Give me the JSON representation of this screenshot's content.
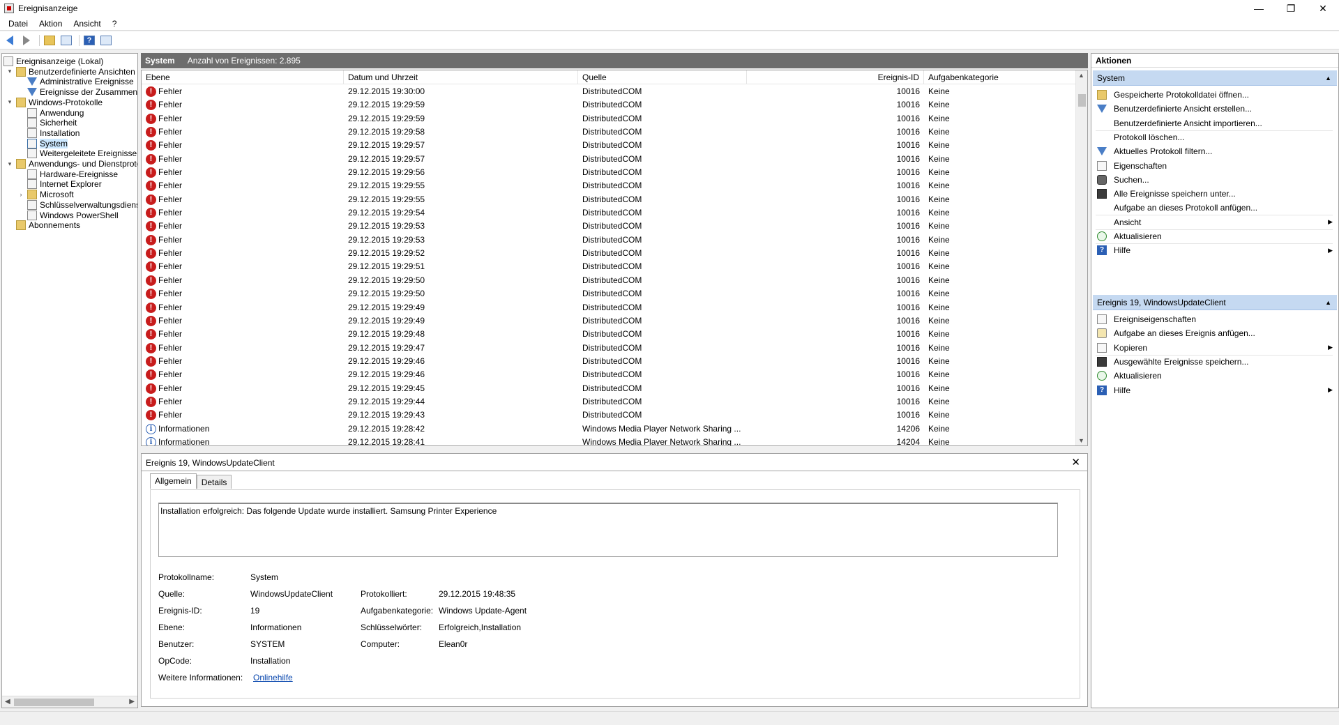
{
  "window": {
    "title": "Ereignisanzeige"
  },
  "menu": [
    "Datei",
    "Aktion",
    "Ansicht",
    "?"
  ],
  "tree": [
    {
      "label": "Ereignisanzeige (Lokal)",
      "level": 0,
      "icon": "eventviewer-icon",
      "twisty": ""
    },
    {
      "label": "Benutzerdefinierte Ansichten",
      "level": 1,
      "icon": "folder-icon",
      "twisty": "▾"
    },
    {
      "label": "Administrative Ereignisse",
      "level": 2,
      "icon": "filter-icon",
      "twisty": ""
    },
    {
      "label": "Ereignisse der Zusammenfassungsseite",
      "level": 2,
      "icon": "filter-icon",
      "twisty": ""
    },
    {
      "label": "Windows-Protokolle",
      "level": 1,
      "icon": "folder-icon",
      "twisty": "▾"
    },
    {
      "label": "Anwendung",
      "level": 2,
      "icon": "log-icon",
      "twisty": ""
    },
    {
      "label": "Sicherheit",
      "level": 2,
      "icon": "log-icon",
      "twisty": ""
    },
    {
      "label": "Installation",
      "level": 2,
      "icon": "log-icon",
      "twisty": ""
    },
    {
      "label": "System",
      "level": 2,
      "icon": "log-icon",
      "twisty": "",
      "selected": true
    },
    {
      "label": "Weitergeleitete Ereignisse",
      "level": 2,
      "icon": "log-icon",
      "twisty": ""
    },
    {
      "label": "Anwendungs- und Dienstprotokolle",
      "level": 1,
      "icon": "folder-icon",
      "twisty": "▾"
    },
    {
      "label": "Hardware-Ereignisse",
      "level": 2,
      "icon": "log-icon",
      "twisty": ""
    },
    {
      "label": "Internet Explorer",
      "level": 2,
      "icon": "log-icon",
      "twisty": ""
    },
    {
      "label": "Microsoft",
      "level": 2,
      "icon": "folder-icon",
      "twisty": "›"
    },
    {
      "label": "Schlüsselverwaltungsdienst",
      "level": 2,
      "icon": "log-icon",
      "twisty": ""
    },
    {
      "label": "Windows PowerShell",
      "level": 2,
      "icon": "log-icon",
      "twisty": ""
    },
    {
      "label": "Abonnements",
      "level": 1,
      "icon": "folder-icon",
      "twisty": ""
    }
  ],
  "list": {
    "name": "System",
    "count_text": "Anzahl von Ereignissen: 2.895",
    "columns": [
      "Ebene",
      "Datum und Uhrzeit",
      "Quelle",
      "Ereignis-ID",
      "Aufgabenkategorie"
    ],
    "rows": [
      {
        "level": "Fehler",
        "type": "err",
        "date": "29.12.2015 19:30:00",
        "source": "DistributedCOM",
        "id": "10016",
        "category": "Keine"
      },
      {
        "level": "Fehler",
        "type": "err",
        "date": "29.12.2015 19:29:59",
        "source": "DistributedCOM",
        "id": "10016",
        "category": "Keine"
      },
      {
        "level": "Fehler",
        "type": "err",
        "date": "29.12.2015 19:29:59",
        "source": "DistributedCOM",
        "id": "10016",
        "category": "Keine"
      },
      {
        "level": "Fehler",
        "type": "err",
        "date": "29.12.2015 19:29:58",
        "source": "DistributedCOM",
        "id": "10016",
        "category": "Keine"
      },
      {
        "level": "Fehler",
        "type": "err",
        "date": "29.12.2015 19:29:57",
        "source": "DistributedCOM",
        "id": "10016",
        "category": "Keine"
      },
      {
        "level": "Fehler",
        "type": "err",
        "date": "29.12.2015 19:29:57",
        "source": "DistributedCOM",
        "id": "10016",
        "category": "Keine"
      },
      {
        "level": "Fehler",
        "type": "err",
        "date": "29.12.2015 19:29:56",
        "source": "DistributedCOM",
        "id": "10016",
        "category": "Keine"
      },
      {
        "level": "Fehler",
        "type": "err",
        "date": "29.12.2015 19:29:55",
        "source": "DistributedCOM",
        "id": "10016",
        "category": "Keine"
      },
      {
        "level": "Fehler",
        "type": "err",
        "date": "29.12.2015 19:29:55",
        "source": "DistributedCOM",
        "id": "10016",
        "category": "Keine"
      },
      {
        "level": "Fehler",
        "type": "err",
        "date": "29.12.2015 19:29:54",
        "source": "DistributedCOM",
        "id": "10016",
        "category": "Keine"
      },
      {
        "level": "Fehler",
        "type": "err",
        "date": "29.12.2015 19:29:53",
        "source": "DistributedCOM",
        "id": "10016",
        "category": "Keine"
      },
      {
        "level": "Fehler",
        "type": "err",
        "date": "29.12.2015 19:29:53",
        "source": "DistributedCOM",
        "id": "10016",
        "category": "Keine"
      },
      {
        "level": "Fehler",
        "type": "err",
        "date": "29.12.2015 19:29:52",
        "source": "DistributedCOM",
        "id": "10016",
        "category": "Keine"
      },
      {
        "level": "Fehler",
        "type": "err",
        "date": "29.12.2015 19:29:51",
        "source": "DistributedCOM",
        "id": "10016",
        "category": "Keine"
      },
      {
        "level": "Fehler",
        "type": "err",
        "date": "29.12.2015 19:29:50",
        "source": "DistributedCOM",
        "id": "10016",
        "category": "Keine"
      },
      {
        "level": "Fehler",
        "type": "err",
        "date": "29.12.2015 19:29:50",
        "source": "DistributedCOM",
        "id": "10016",
        "category": "Keine"
      },
      {
        "level": "Fehler",
        "type": "err",
        "date": "29.12.2015 19:29:49",
        "source": "DistributedCOM",
        "id": "10016",
        "category": "Keine"
      },
      {
        "level": "Fehler",
        "type": "err",
        "date": "29.12.2015 19:29:49",
        "source": "DistributedCOM",
        "id": "10016",
        "category": "Keine"
      },
      {
        "level": "Fehler",
        "type": "err",
        "date": "29.12.2015 19:29:48",
        "source": "DistributedCOM",
        "id": "10016",
        "category": "Keine"
      },
      {
        "level": "Fehler",
        "type": "err",
        "date": "29.12.2015 19:29:47",
        "source": "DistributedCOM",
        "id": "10016",
        "category": "Keine"
      },
      {
        "level": "Fehler",
        "type": "err",
        "date": "29.12.2015 19:29:46",
        "source": "DistributedCOM",
        "id": "10016",
        "category": "Keine"
      },
      {
        "level": "Fehler",
        "type": "err",
        "date": "29.12.2015 19:29:46",
        "source": "DistributedCOM",
        "id": "10016",
        "category": "Keine"
      },
      {
        "level": "Fehler",
        "type": "err",
        "date": "29.12.2015 19:29:45",
        "source": "DistributedCOM",
        "id": "10016",
        "category": "Keine"
      },
      {
        "level": "Fehler",
        "type": "err",
        "date": "29.12.2015 19:29:44",
        "source": "DistributedCOM",
        "id": "10016",
        "category": "Keine"
      },
      {
        "level": "Fehler",
        "type": "err",
        "date": "29.12.2015 19:29:43",
        "source": "DistributedCOM",
        "id": "10016",
        "category": "Keine"
      },
      {
        "level": "Informationen",
        "type": "inf",
        "date": "29.12.2015 19:28:42",
        "source": "Windows Media Player Network Sharing ...",
        "id": "14206",
        "category": "Keine"
      },
      {
        "level": "Informationen",
        "type": "inf",
        "date": "29.12.2015 19:28:41",
        "source": "Windows Media Player Network Sharing ...",
        "id": "14204",
        "category": "Keine"
      }
    ]
  },
  "detail": {
    "title": "Ereignis 19, WindowsUpdateClient",
    "tabs": [
      "Allgemein",
      "Details"
    ],
    "message": "Installation erfolgreich: Das folgende Update wurde installiert. Samsung Printer Experience",
    "fields": {
      "protokollname_label": "Protokollname:",
      "protokollname": "System",
      "quelle_label": "Quelle:",
      "quelle": "WindowsUpdateClient",
      "protokolliert_label": "Protokolliert:",
      "protokolliert": "29.12.2015 19:48:35",
      "id_label": "Ereignis-ID:",
      "id": "19",
      "aufgabe_label": "Aufgabenkategorie:",
      "aufgabe": "Windows Update-Agent",
      "ebene_label": "Ebene:",
      "ebene": "Informationen",
      "schluessel_label": "Schlüsselwörter:",
      "schluessel": "Erfolgreich,Installation",
      "benutzer_label": "Benutzer:",
      "benutzer": "SYSTEM",
      "computer_label": "Computer:",
      "computer": "Elean0r",
      "opcode_label": "OpCode:",
      "opcode": "Installation",
      "weitere_label": "Weitere Informationen:",
      "weitere": "Onlinehilfe"
    }
  },
  "actions": {
    "title": "Aktionen",
    "section1": "System",
    "section1_items": [
      {
        "label": "Gespeicherte Protokolldatei öffnen...",
        "icon": "open-icon",
        "sub": false
      },
      {
        "label": "Benutzerdefinierte Ansicht erstellen...",
        "icon": "filter-icon",
        "sub": false
      },
      {
        "label": "Benutzerdefinierte Ansicht importieren...",
        "icon": "blank-icon",
        "sub": false
      },
      {
        "label": "Protokoll löschen...",
        "icon": "blank-icon",
        "sub": false
      },
      {
        "label": "Aktuelles Protokoll filtern...",
        "icon": "filter-icon",
        "sub": false
      },
      {
        "label": "Eigenschaften",
        "icon": "properties-icon",
        "sub": false
      },
      {
        "label": "Suchen...",
        "icon": "binoculars-icon",
        "sub": false
      },
      {
        "label": "Alle Ereignisse speichern unter...",
        "icon": "save-icon",
        "sub": false
      },
      {
        "label": "Aufgabe an dieses Protokoll anfügen...",
        "icon": "blank-icon",
        "sub": false
      },
      {
        "label": "Ansicht",
        "icon": "blank-icon",
        "sub": true
      },
      {
        "label": "Aktualisieren",
        "icon": "refresh-icon",
        "sub": false
      },
      {
        "label": "Hilfe",
        "icon": "help-icon",
        "sub": true
      }
    ],
    "section2": "Ereignis 19, WindowsUpdateClient",
    "section2_items": [
      {
        "label": "Ereigniseigenschaften",
        "icon": "properties-icon",
        "sub": false
      },
      {
        "label": "Aufgabe an dieses Ereignis anfügen...",
        "icon": "task-icon",
        "sub": false
      },
      {
        "label": "Kopieren",
        "icon": "copy-icon",
        "sub": true
      },
      {
        "label": "Ausgewählte Ereignisse speichern...",
        "icon": "save-icon",
        "sub": false
      },
      {
        "label": "Aktualisieren",
        "icon": "refresh-icon",
        "sub": false
      },
      {
        "label": "Hilfe",
        "icon": "help-icon",
        "sub": true
      }
    ]
  },
  "colors": {
    "header_bg": "#6d6d6d",
    "section_bg": "#c5d9f1",
    "error": "#c81c1c",
    "link": "#0645ad"
  }
}
